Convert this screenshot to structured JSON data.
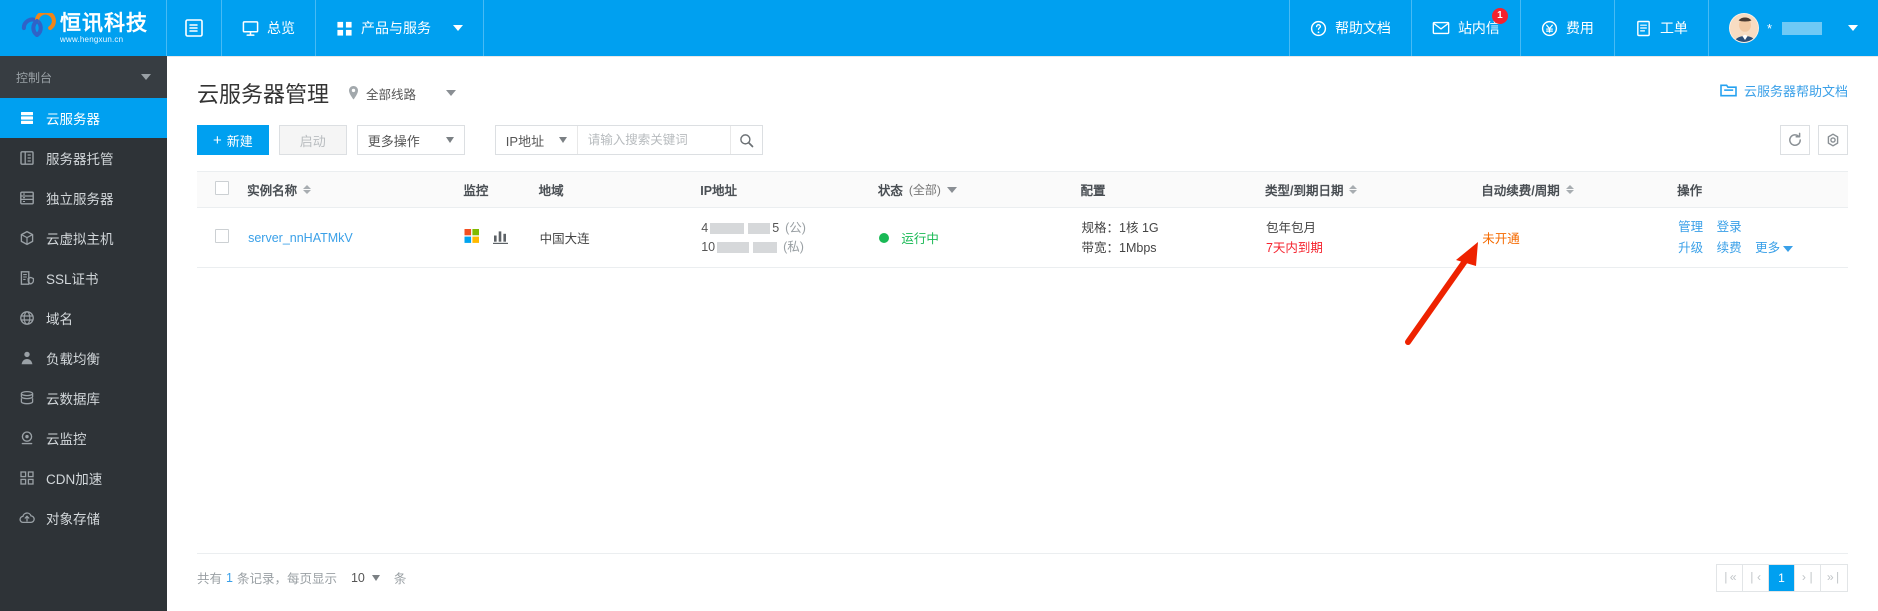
{
  "header": {
    "logo_cn": "恒讯科技",
    "logo_en": "www.hengxun.cn",
    "collapse_icon": "collapse-icon",
    "nav": [
      {
        "label": "总览",
        "icon": "monitor-icon"
      },
      {
        "label": "产品与服务",
        "icon": "grid-icon",
        "has_caret": true
      }
    ],
    "right_nav": [
      {
        "label": "帮助文档",
        "icon": "question-circle-icon"
      },
      {
        "label": "站内信",
        "icon": "envelope-icon",
        "badge": "1"
      },
      {
        "label": "费用",
        "icon": "yen-circle-icon"
      },
      {
        "label": "工单",
        "icon": "document-icon"
      }
    ],
    "user": {
      "name_prefix": "*",
      "name_masked": true,
      "avatar": "user-avatar"
    }
  },
  "sidebar": {
    "title": "控制台",
    "items": [
      {
        "label": "云服务器",
        "icon": "server-icon",
        "active": true
      },
      {
        "label": "服务器托管",
        "icon": "rack-icon",
        "active": false
      },
      {
        "label": "独立服务器",
        "icon": "list-icon",
        "active": false
      },
      {
        "label": "云虚拟主机",
        "icon": "cube-icon",
        "active": false
      },
      {
        "label": "SSL证书",
        "icon": "certificate-icon",
        "active": false
      },
      {
        "label": "域名",
        "icon": "globe-icon",
        "active": false
      },
      {
        "label": "负载均衡",
        "icon": "balance-icon",
        "active": false
      },
      {
        "label": "云数据库",
        "icon": "database-icon",
        "active": false
      },
      {
        "label": "云监控",
        "icon": "monitor-eye-icon",
        "active": false
      },
      {
        "label": "CDN加速",
        "icon": "cdn-grid-icon",
        "active": false
      },
      {
        "label": "对象存储",
        "icon": "cloud-upload-icon",
        "active": false
      }
    ]
  },
  "page": {
    "title": "云服务器管理",
    "region": "全部线路",
    "region_icon": "location-pin-icon",
    "help_doc": "云服务器帮助文档",
    "help_doc_icon": "folder-icon"
  },
  "toolbar": {
    "create_label": "新建",
    "create_icon": "plus-icon",
    "start_label": "启动",
    "more_ops_label": "更多操作",
    "search_type": "IP地址",
    "search_placeholder": "请输入搜索关键词",
    "search_value": "",
    "search_icon": "search-icon",
    "refresh_icon": "refresh-icon",
    "settings_icon": "gear-icon"
  },
  "table": {
    "columns": [
      {
        "key": "checkbox",
        "label": ""
      },
      {
        "key": "name",
        "label": "实例名称",
        "sortable": true
      },
      {
        "key": "monitor",
        "label": "监控"
      },
      {
        "key": "region",
        "label": "地域"
      },
      {
        "key": "ip",
        "label": "IP地址"
      },
      {
        "key": "status",
        "label": "状态",
        "sub": "(全部)",
        "filterable": true
      },
      {
        "key": "config",
        "label": "配置"
      },
      {
        "key": "type",
        "label": "类型/到期日期",
        "sortable": true
      },
      {
        "key": "renew",
        "label": "自动续费/周期",
        "sortable": true
      },
      {
        "key": "operation",
        "label": "操作"
      }
    ],
    "rows": [
      {
        "name": "server_nnHATMkV",
        "monitor_icons": [
          "windows-logo-icon",
          "bar-chart-icon"
        ],
        "region": "中国大连",
        "ip_public_prefix": "4",
        "ip_public_suffix": "5",
        "ip_public_tag": "(公)",
        "ip_private_prefix": "10",
        "ip_private_suffix": "",
        "ip_private_tag": "(私)",
        "status": "运行中",
        "status_color": "#19b955",
        "config_spec": "规格：1核 1G",
        "config_bandwidth": "带宽：1Mbps",
        "type": "包年包月",
        "expiry": "7天内到期",
        "expiry_color": "#f5222d",
        "auto_renew": "未开通",
        "auto_renew_color": "#f56a00",
        "operations": [
          "管理",
          "登录",
          "升级",
          "续费",
          "更多"
        ]
      }
    ]
  },
  "footer": {
    "total_prefix": "共有",
    "total_count": "1",
    "total_suffix": "条记录，每页显示",
    "page_size": "10",
    "unit": "条",
    "pager": {
      "first": "|«",
      "prev": "|‹",
      "current": "1",
      "next": "›|",
      "last": "»|"
    }
  },
  "annotation": {
    "arrow_color": "#ee2200",
    "points_to": "续费"
  }
}
